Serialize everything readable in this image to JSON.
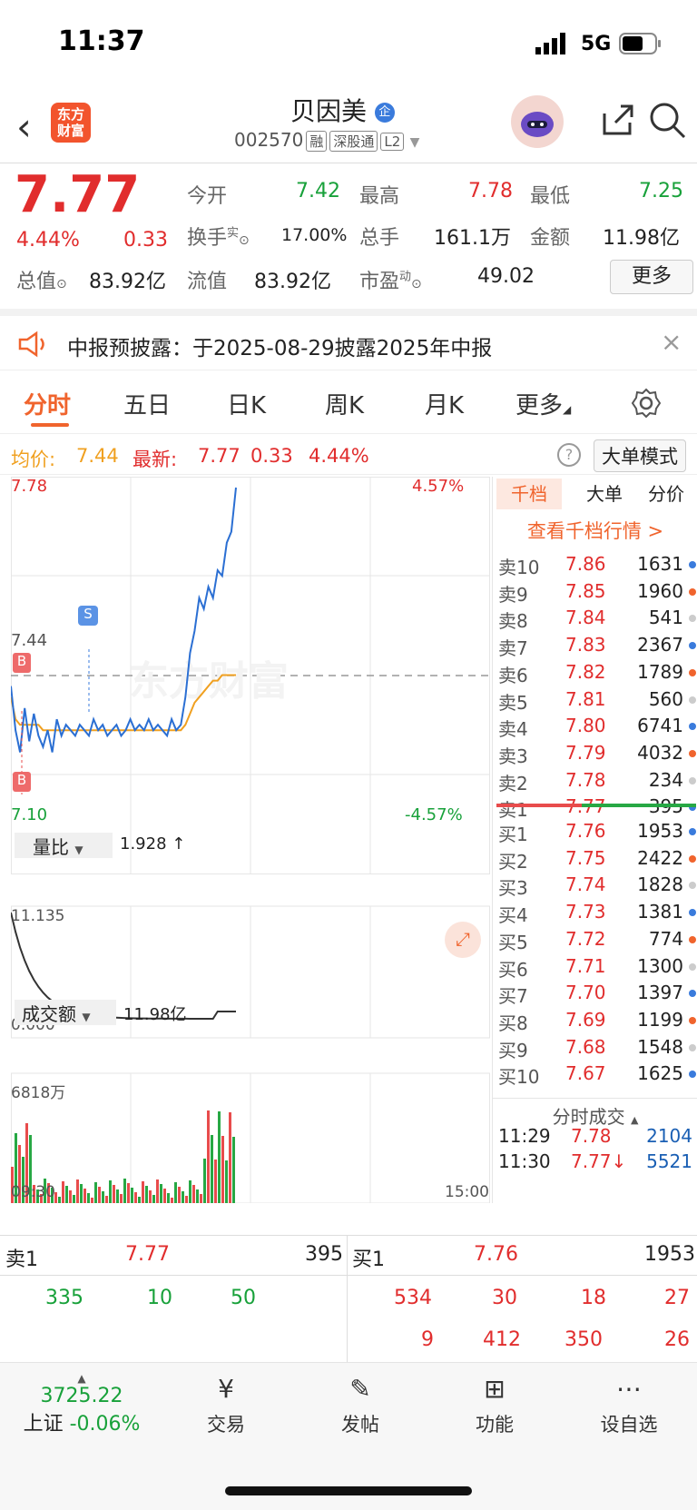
{
  "status": {
    "time": "11:37",
    "network": "5G"
  },
  "header": {
    "logo": "东方\n财富",
    "name": "贝因美",
    "badge": "企",
    "code": "002570",
    "tags": [
      "融",
      "深股通",
      "L2"
    ]
  },
  "quote": {
    "price": "7.77",
    "pct": "4.44%",
    "chg": "0.33",
    "open_label": "今开",
    "open": "7.42",
    "high_label": "最高",
    "high": "7.78",
    "low_label": "最低",
    "low": "7.25",
    "turnover_label": "换手",
    "turnover_sup": "实",
    "turnover": "17.00%",
    "vol_label": "总手",
    "vol": "161.1万",
    "amt_label": "金额",
    "amt": "11.98亿",
    "mcap_label": "总值",
    "mcap": "83.92亿",
    "float_label": "流值",
    "float": "83.92亿",
    "pe_label": "市盈",
    "pe_sup": "动",
    "pe": "49.02",
    "more": "更多"
  },
  "notice": {
    "text": "中报预披露：于2025-08-29披露2025年中报"
  },
  "tabs": [
    "分时",
    "五日",
    "日K",
    "周K",
    "月K",
    "更多"
  ],
  "info": {
    "avg_label": "均价:",
    "avg": "7.44",
    "new_label": "最新:",
    "new": "7.77",
    "chg": "0.33",
    "pct": "4.44%",
    "mode": "大单模式"
  },
  "chart": {
    "ymax": "7.78",
    "ymin": "7.10",
    "pmax": "4.57%",
    "pmin": "-4.57%",
    "mid": "7.44",
    "watermark": "东方财富",
    "markers": [
      "B",
      "S",
      "B"
    ],
    "vr_label": "量比",
    "vr_value": "1.928 ↑",
    "vr_max": "11.135",
    "vr_min": "0.000",
    "amt_label": "成交额",
    "amt_value": "11.98亿",
    "amt_max": "6818万",
    "t_start": "09:30",
    "t_end": "15:00"
  },
  "orderbook": {
    "tabs": [
      "千档",
      "大单",
      "分价"
    ],
    "link": "查看千档行情 >",
    "sells": [
      [
        "卖10",
        "7.86",
        "1631"
      ],
      [
        "卖9",
        "7.85",
        "1960"
      ],
      [
        "卖8",
        "7.84",
        "541"
      ],
      [
        "卖7",
        "7.83",
        "2367"
      ],
      [
        "卖6",
        "7.82",
        "1789"
      ],
      [
        "卖5",
        "7.81",
        "560"
      ],
      [
        "卖4",
        "7.80",
        "6741"
      ],
      [
        "卖3",
        "7.79",
        "4032"
      ],
      [
        "卖2",
        "7.78",
        "234"
      ],
      [
        "卖1",
        "7.77",
        "395"
      ]
    ],
    "buys": [
      [
        "买1",
        "7.76",
        "1953"
      ],
      [
        "买2",
        "7.75",
        "2422"
      ],
      [
        "买3",
        "7.74",
        "1828"
      ],
      [
        "买4",
        "7.73",
        "1381"
      ],
      [
        "买5",
        "7.72",
        "774"
      ],
      [
        "买6",
        "7.71",
        "1300"
      ],
      [
        "买7",
        "7.70",
        "1397"
      ],
      [
        "买8",
        "7.69",
        "1199"
      ],
      [
        "买9",
        "7.68",
        "1548"
      ],
      [
        "买10",
        "7.67",
        "1625"
      ]
    ],
    "trades_label": "分时成交",
    "trades": [
      [
        "11:29",
        "7.78",
        "2104"
      ],
      [
        "11:30",
        "7.77↓",
        "5521"
      ]
    ]
  },
  "bottom": {
    "s1": "卖1",
    "s1p": "7.77",
    "s1v": "395",
    "b1": "买1",
    "b1p": "7.76",
    "b1v": "1953",
    "left": [
      "335",
      "10",
      "50"
    ],
    "right1": [
      "534",
      "30",
      "18",
      "27"
    ],
    "right2": [
      "9",
      "412",
      "350",
      "26"
    ]
  },
  "toolbar": {
    "index": "3725.22",
    "index_name": "上证",
    "index_chg": "-0.06%",
    "items": [
      "交易",
      "发帖",
      "功能",
      "设自选"
    ]
  }
}
